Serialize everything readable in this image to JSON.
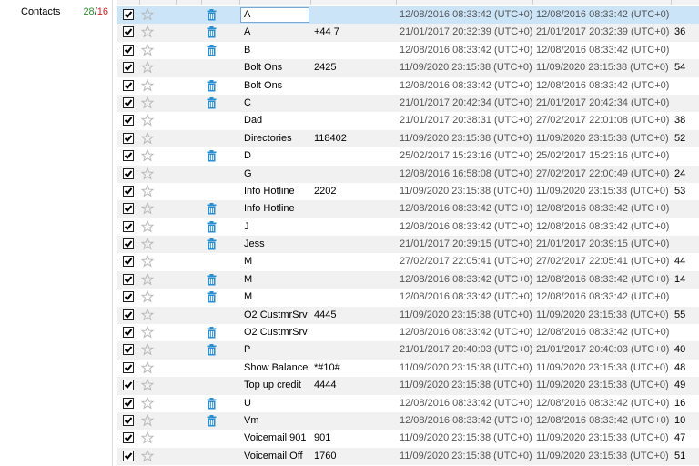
{
  "sidebar": {
    "items": [
      {
        "label": "Contacts",
        "count_a": "28",
        "sep": "/",
        "count_b": "16"
      }
    ]
  },
  "colors": {
    "selected_row": "#cce4f7",
    "alt_row": "#f1f1f1",
    "count_green": "#2e8b2e",
    "count_red": "#d21f1f",
    "trash_blue": "#2a8fd0"
  },
  "rows": [
    {
      "checked": true,
      "starred": false,
      "trash": true,
      "name": "A",
      "phone": "",
      "created": "12/08/2016 08:33:42 (UTC+0)",
      "modified": "12/08/2016 08:33:42 (UTC+0)",
      "index": ""
    },
    {
      "checked": true,
      "starred": false,
      "trash": true,
      "name": "A",
      "phone": "+44 7",
      "created": "21/01/2017 20:32:39 (UTC+0)",
      "modified": "21/01/2017 20:32:39 (UTC+0)",
      "index": "36"
    },
    {
      "checked": true,
      "starred": false,
      "trash": true,
      "name": "B",
      "phone": "",
      "created": "12/08/2016 08:33:42 (UTC+0)",
      "modified": "12/08/2016 08:33:42 (UTC+0)",
      "index": ""
    },
    {
      "checked": true,
      "starred": false,
      "trash": false,
      "name": "Bolt Ons",
      "phone": "2425",
      "created": "11/09/2020 23:15:38 (UTC+0)",
      "modified": "11/09/2020 23:15:38 (UTC+0)",
      "index": "54"
    },
    {
      "checked": true,
      "starred": false,
      "trash": true,
      "name": "Bolt Ons",
      "phone": "",
      "created": "12/08/2016 08:33:42 (UTC+0)",
      "modified": "12/08/2016 08:33:42 (UTC+0)",
      "index": ""
    },
    {
      "checked": true,
      "starred": false,
      "trash": true,
      "name": "C",
      "phone": "",
      "created": "21/01/2017 20:42:34 (UTC+0)",
      "modified": "21/01/2017 20:42:34 (UTC+0)",
      "index": ""
    },
    {
      "checked": true,
      "starred": false,
      "trash": false,
      "name": "Dad",
      "phone": "",
      "created": "21/01/2017 20:38:31 (UTC+0)",
      "modified": "27/02/2017 22:01:08 (UTC+0)",
      "index": "38"
    },
    {
      "checked": true,
      "starred": false,
      "trash": false,
      "name": "Directories",
      "phone": "118402",
      "created": "11/09/2020 23:15:38 (UTC+0)",
      "modified": "11/09/2020 23:15:38 (UTC+0)",
      "index": "52"
    },
    {
      "checked": true,
      "starred": false,
      "trash": true,
      "name": "D",
      "phone": "",
      "created": "25/02/2017 15:23:16 (UTC+0)",
      "modified": "25/02/2017 15:23:16 (UTC+0)",
      "index": ""
    },
    {
      "checked": true,
      "starred": false,
      "trash": false,
      "name": "G",
      "phone": "",
      "created": "12/08/2016 16:58:08 (UTC+0)",
      "modified": "27/02/2017 22:00:49 (UTC+0)",
      "index": "24"
    },
    {
      "checked": true,
      "starred": false,
      "trash": false,
      "name": "Info Hotline",
      "phone": "2202",
      "created": "11/09/2020 23:15:38 (UTC+0)",
      "modified": "11/09/2020 23:15:38 (UTC+0)",
      "index": "53"
    },
    {
      "checked": true,
      "starred": false,
      "trash": true,
      "name": "Info Hotline",
      "phone": "",
      "created": "12/08/2016 08:33:42 (UTC+0)",
      "modified": "12/08/2016 08:33:42 (UTC+0)",
      "index": ""
    },
    {
      "checked": true,
      "starred": false,
      "trash": true,
      "name": "J",
      "phone": "",
      "created": "12/08/2016 08:33:42 (UTC+0)",
      "modified": "12/08/2016 08:33:42 (UTC+0)",
      "index": ""
    },
    {
      "checked": true,
      "starred": false,
      "trash": true,
      "name": "Jess",
      "phone": "",
      "created": "21/01/2017 20:39:15 (UTC+0)",
      "modified": "21/01/2017 20:39:15 (UTC+0)",
      "index": ""
    },
    {
      "checked": true,
      "starred": false,
      "trash": false,
      "name": "M",
      "phone": "",
      "created": "27/02/2017 22:05:41 (UTC+0)",
      "modified": "27/02/2017 22:05:41 (UTC+0)",
      "index": "44"
    },
    {
      "checked": true,
      "starred": false,
      "trash": true,
      "name": "M",
      "phone": "",
      "created": "12/08/2016 08:33:42 (UTC+0)",
      "modified": "12/08/2016 08:33:42 (UTC+0)",
      "index": "14"
    },
    {
      "checked": true,
      "starred": false,
      "trash": true,
      "name": "M",
      "phone": "",
      "created": "12/08/2016 08:33:42 (UTC+0)",
      "modified": "12/08/2016 08:33:42 (UTC+0)",
      "index": ""
    },
    {
      "checked": true,
      "starred": false,
      "trash": false,
      "name": "O2 CustmrSrv",
      "phone": "4445",
      "created": "11/09/2020 23:15:38 (UTC+0)",
      "modified": "11/09/2020 23:15:38 (UTC+0)",
      "index": "55"
    },
    {
      "checked": true,
      "starred": false,
      "trash": true,
      "name": "O2 CustmrSrv",
      "phone": "",
      "created": "12/08/2016 08:33:42 (UTC+0)",
      "modified": "12/08/2016 08:33:42 (UTC+0)",
      "index": ""
    },
    {
      "checked": true,
      "starred": false,
      "trash": true,
      "name": "P",
      "phone": "",
      "created": "21/01/2017 20:40:03 (UTC+0)",
      "modified": "21/01/2017 20:40:03 (UTC+0)",
      "index": "40"
    },
    {
      "checked": true,
      "starred": false,
      "trash": false,
      "name": "Show Balance",
      "phone": "*#10#",
      "created": "11/09/2020 23:15:38 (UTC+0)",
      "modified": "11/09/2020 23:15:38 (UTC+0)",
      "index": "48"
    },
    {
      "checked": true,
      "starred": false,
      "trash": false,
      "name": "Top up credit",
      "phone": "4444",
      "created": "11/09/2020 23:15:38 (UTC+0)",
      "modified": "11/09/2020 23:15:38 (UTC+0)",
      "index": "49"
    },
    {
      "checked": true,
      "starred": false,
      "trash": true,
      "name": "U",
      "phone": "",
      "created": "12/08/2016 08:33:42 (UTC+0)",
      "modified": "12/08/2016 08:33:42 (UTC+0)",
      "index": "16"
    },
    {
      "checked": true,
      "starred": false,
      "trash": true,
      "name": "Vm",
      "phone": "",
      "created": "12/08/2016 08:33:42 (UTC+0)",
      "modified": "12/08/2016 08:33:42 (UTC+0)",
      "index": "10"
    },
    {
      "checked": true,
      "starred": false,
      "trash": false,
      "name": "Voicemail 901",
      "phone": "901",
      "created": "11/09/2020 23:15:38 (UTC+0)",
      "modified": "11/09/2020 23:15:38 (UTC+0)",
      "index": "47"
    },
    {
      "checked": true,
      "starred": false,
      "trash": false,
      "name": "Voicemail Off",
      "phone": "1760",
      "created": "11/09/2020 23:15:38 (UTC+0)",
      "modified": "11/09/2020 23:15:38 (UTC+0)",
      "index": "51"
    }
  ]
}
